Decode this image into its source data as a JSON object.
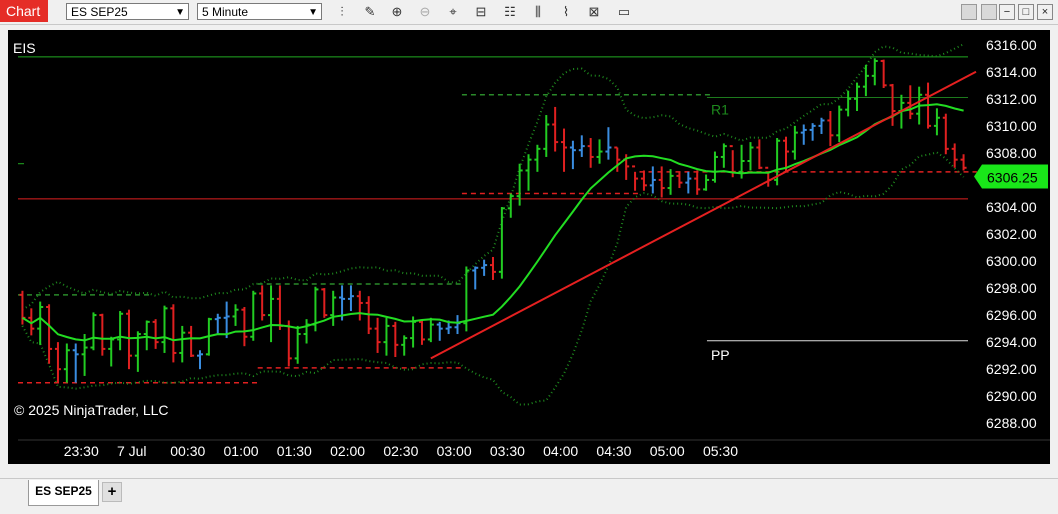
{
  "header": {
    "chart_label": "Chart",
    "instrument": "ES SEP25",
    "interval": "5 Minute",
    "tools": [
      "bars-type-icon",
      "draw-icon",
      "zoom-in-icon",
      "zoom-out-icon",
      "crosshair-icon",
      "data-box-icon",
      "properties-icon",
      "strategies-icon",
      "indicators-icon",
      "templates-icon",
      "chart-trader-icon"
    ],
    "window_buttons": [
      "layout-icon",
      "tile-icon",
      "minimize-icon",
      "maximize-icon",
      "close-icon"
    ]
  },
  "chart": {
    "instrument_label": "EIS",
    "copyright": "© 2025 NinjaTrader, LLC",
    "current_price": "6306.25",
    "pivot_labels": {
      "r1": "R1",
      "pp": "PP"
    },
    "price_ticks": [
      "6316.00",
      "6314.00",
      "6312.00",
      "6310.00",
      "6308.00",
      "6306.00",
      "6304.00",
      "6302.00",
      "6300.00",
      "6298.00",
      "6296.00",
      "6294.00",
      "6292.00",
      "6290.00",
      "6288.00"
    ],
    "time_ticks": [
      "23:30",
      "7 Jul",
      "00:30",
      "01:00",
      "01:30",
      "02:00",
      "02:30",
      "03:00",
      "03:30",
      "04:00",
      "04:30",
      "05:00",
      "05:30"
    ]
  },
  "chart_data": {
    "type": "candlestick",
    "ylim": [
      6287.5,
      6316.5
    ],
    "current_price": 6306.25,
    "colors": {
      "up": "#22cc22",
      "down": "#e02020",
      "neutral": "#3a8de0",
      "ma": "#22dd22",
      "bands": "#1e8a1e",
      "trendline": "#e52020",
      "price_tag": "#19e619",
      "support": "#e02020",
      "resistance": "#2a8a2a"
    },
    "levels": {
      "r1": 6312.1,
      "pp": 6294.1,
      "top_line": 6315.1,
      "horizontal_red": 6304.6
    },
    "bars": [
      [
        6297.5,
        6297.8,
        6295.3,
        6295.8
      ],
      [
        6295.8,
        6296.5,
        6294.5,
        6295.0
      ],
      [
        6295.0,
        6297.0,
        6293.8,
        6296.6
      ],
      [
        6296.6,
        6296.8,
        6292.4,
        6293.5
      ],
      [
        6293.5,
        6294.0,
        6291.0,
        6292.0
      ],
      [
        6292.0,
        6293.9,
        6291.0,
        6293.4
      ],
      [
        6293.4,
        6293.9,
        6291.0,
        6293.1
      ],
      [
        6293.1,
        6294.6,
        6291.5,
        6293.6
      ],
      [
        6293.6,
        6296.2,
        6293.4,
        6296.0
      ],
      [
        6296.0,
        6296.1,
        6293.0,
        6293.5
      ],
      [
        6293.5,
        6294.4,
        6292.2,
        6294.2
      ],
      [
        6294.2,
        6296.3,
        6293.4,
        6296.1
      ],
      [
        6296.1,
        6296.4,
        6292.0,
        6293.0
      ],
      [
        6293.0,
        6294.8,
        6291.8,
        6294.6
      ],
      [
        6294.6,
        6295.6,
        6293.4,
        6295.5
      ],
      [
        6295.5,
        6295.7,
        6293.5,
        6294.0
      ],
      [
        6294.0,
        6296.7,
        6293.2,
        6296.5
      ],
      [
        6296.5,
        6296.8,
        6292.5,
        6293.2
      ],
      [
        6293.2,
        6295.2,
        6292.5,
        6294.7
      ],
      [
        6294.7,
        6295.2,
        6292.9,
        6293.0
      ],
      [
        6293.0,
        6293.4,
        6292.0,
        6293.1
      ],
      [
        6293.1,
        6295.8,
        6293.0,
        6295.7
      ],
      [
        6295.7,
        6296.1,
        6294.6,
        6295.8
      ],
      [
        6295.8,
        6297.0,
        6294.3,
        6295.9
      ],
      [
        6295.9,
        6296.8,
        6295.2,
        6296.4
      ],
      [
        6296.4,
        6296.6,
        6293.7,
        6294.4
      ],
      [
        6294.4,
        6297.8,
        6294.1,
        6297.6
      ],
      [
        6297.6,
        6298.2,
        6295.6,
        6296.0
      ],
      [
        6296.0,
        6298.2,
        6294.0,
        6297.2
      ],
      [
        6297.2,
        6298.2,
        6294.9,
        6295.2
      ],
      [
        6295.2,
        6295.6,
        6292.2,
        6292.8
      ],
      [
        6292.8,
        6295.2,
        6292.4,
        6294.6
      ],
      [
        6294.6,
        6295.7,
        6293.9,
        6295.3
      ],
      [
        6295.3,
        6298.1,
        6294.8,
        6297.9
      ],
      [
        6297.9,
        6298.0,
        6295.8,
        6296.0
      ],
      [
        6296.0,
        6297.8,
        6295.2,
        6297.3
      ],
      [
        6297.3,
        6298.2,
        6295.6,
        6297.2
      ],
      [
        6297.2,
        6298.2,
        6296.3,
        6297.4
      ],
      [
        6297.4,
        6297.8,
        6295.6,
        6296.9
      ],
      [
        6296.9,
        6297.4,
        6294.6,
        6295.0
      ],
      [
        6295.0,
        6295.8,
        6293.2,
        6294.0
      ],
      [
        6294.0,
        6295.8,
        6293.0,
        6295.2
      ],
      [
        6295.2,
        6295.5,
        6292.9,
        6293.8
      ],
      [
        6293.8,
        6294.5,
        6293.0,
        6294.3
      ],
      [
        6294.3,
        6295.9,
        6293.6,
        6295.5
      ],
      [
        6295.5,
        6295.6,
        6293.8,
        6294.2
      ],
      [
        6294.2,
        6295.8,
        6294.0,
        6295.3
      ],
      [
        6295.3,
        6295.5,
        6294.1,
        6295.0
      ],
      [
        6295.0,
        6295.6,
        6294.6,
        6295.1
      ],
      [
        6295.1,
        6296.0,
        6294.6,
        6295.4
      ],
      [
        6295.4,
        6299.6,
        6294.8,
        6299.3
      ],
      [
        6299.3,
        6299.6,
        6297.9,
        6299.5
      ],
      [
        6299.5,
        6300.1,
        6298.9,
        6299.7
      ],
      [
        6299.7,
        6300.3,
        6298.6,
        6299.2
      ],
      [
        6299.2,
        6304.0,
        6298.7,
        6303.9
      ],
      [
        6303.9,
        6305.0,
        6303.2,
        6304.8
      ],
      [
        6304.8,
        6307.2,
        6304.1,
        6306.7
      ],
      [
        6306.7,
        6307.9,
        6305.2,
        6307.5
      ],
      [
        6307.5,
        6308.6,
        6306.6,
        6308.3
      ],
      [
        6308.3,
        6310.8,
        6307.7,
        6310.1
      ],
      [
        6310.1,
        6311.4,
        6308.1,
        6308.8
      ],
      [
        6308.8,
        6309.8,
        6306.6,
        6308.4
      ],
      [
        6308.4,
        6308.9,
        6306.8,
        6308.2
      ],
      [
        6308.2,
        6309.3,
        6307.7,
        6308.5
      ],
      [
        6308.5,
        6309.1,
        6306.9,
        6307.7
      ],
      [
        6307.7,
        6309.0,
        6307.2,
        6308.1
      ],
      [
        6308.1,
        6309.9,
        6307.5,
        6308.4
      ],
      [
        6308.4,
        6308.4,
        6306.6,
        6307.5
      ],
      [
        6307.5,
        6307.9,
        6306.0,
        6307.0
      ],
      [
        6307.0,
        6306.6,
        6305.2,
        6306.1
      ],
      [
        6306.1,
        6306.7,
        6305.2,
        6305.6
      ],
      [
        6305.6,
        6307.0,
        6305.0,
        6306.0
      ],
      [
        6306.0,
        6307.0,
        6304.7,
        6305.4
      ],
      [
        6305.4,
        6306.8,
        6304.9,
        6306.3
      ],
      [
        6306.3,
        6306.6,
        6305.4,
        6305.8
      ],
      [
        6305.8,
        6306.6,
        6305.0,
        6306.1
      ],
      [
        6306.1,
        6306.7,
        6304.9,
        6305.3
      ],
      [
        6305.3,
        6306.4,
        6305.2,
        6306.0
      ],
      [
        6306.0,
        6308.1,
        6305.8,
        6307.7
      ],
      [
        6307.7,
        6308.7,
        6306.9,
        6308.5
      ],
      [
        6308.5,
        6308.2,
        6306.2,
        6306.6
      ],
      [
        6306.6,
        6308.6,
        6306.1,
        6307.4
      ],
      [
        6307.4,
        6308.8,
        6306.7,
        6308.4
      ],
      [
        6308.4,
        6309.0,
        6306.8,
        6306.9
      ],
      [
        6306.9,
        6306.6,
        6305.5,
        6306.0
      ],
      [
        6306.0,
        6309.1,
        6305.6,
        6308.9
      ],
      [
        6308.9,
        6309.2,
        6306.6,
        6308.1
      ],
      [
        6308.1,
        6310.0,
        6307.5,
        6309.5
      ],
      [
        6309.5,
        6310.1,
        6308.6,
        6309.7
      ],
      [
        6309.7,
        6310.2,
        6308.9,
        6310.0
      ],
      [
        6310.0,
        6310.6,
        6309.4,
        6310.4
      ],
      [
        6310.4,
        6311.1,
        6308.5,
        6309.3
      ],
      [
        6309.3,
        6311.5,
        6308.8,
        6311.2
      ],
      [
        6311.2,
        6312.6,
        6310.7,
        6312.0
      ],
      [
        6312.0,
        6313.2,
        6311.1,
        6312.9
      ],
      [
        6312.9,
        6314.5,
        6312.2,
        6313.7
      ],
      [
        6313.7,
        6315.0,
        6313.0,
        6314.8
      ],
      [
        6314.8,
        6314.9,
        6312.8,
        6313.0
      ],
      [
        6313.0,
        6313.1,
        6310.0,
        6311.1
      ],
      [
        6311.1,
        6312.3,
        6309.8,
        6311.7
      ],
      [
        6311.7,
        6313.0,
        6310.5,
        6310.9
      ],
      [
        6310.9,
        6312.9,
        6310.1,
        6312.3
      ],
      [
        6312.3,
        6313.2,
        6309.8,
        6310.0
      ],
      [
        6310.0,
        6311.3,
        6309.3,
        6310.6
      ],
      [
        6310.6,
        6310.9,
        6307.9,
        6308.3
      ],
      [
        6308.3,
        6308.7,
        6306.9,
        6307.5
      ],
      [
        6307.5,
        6307.9,
        6306.7,
        6306.9
      ]
    ]
  }
}
